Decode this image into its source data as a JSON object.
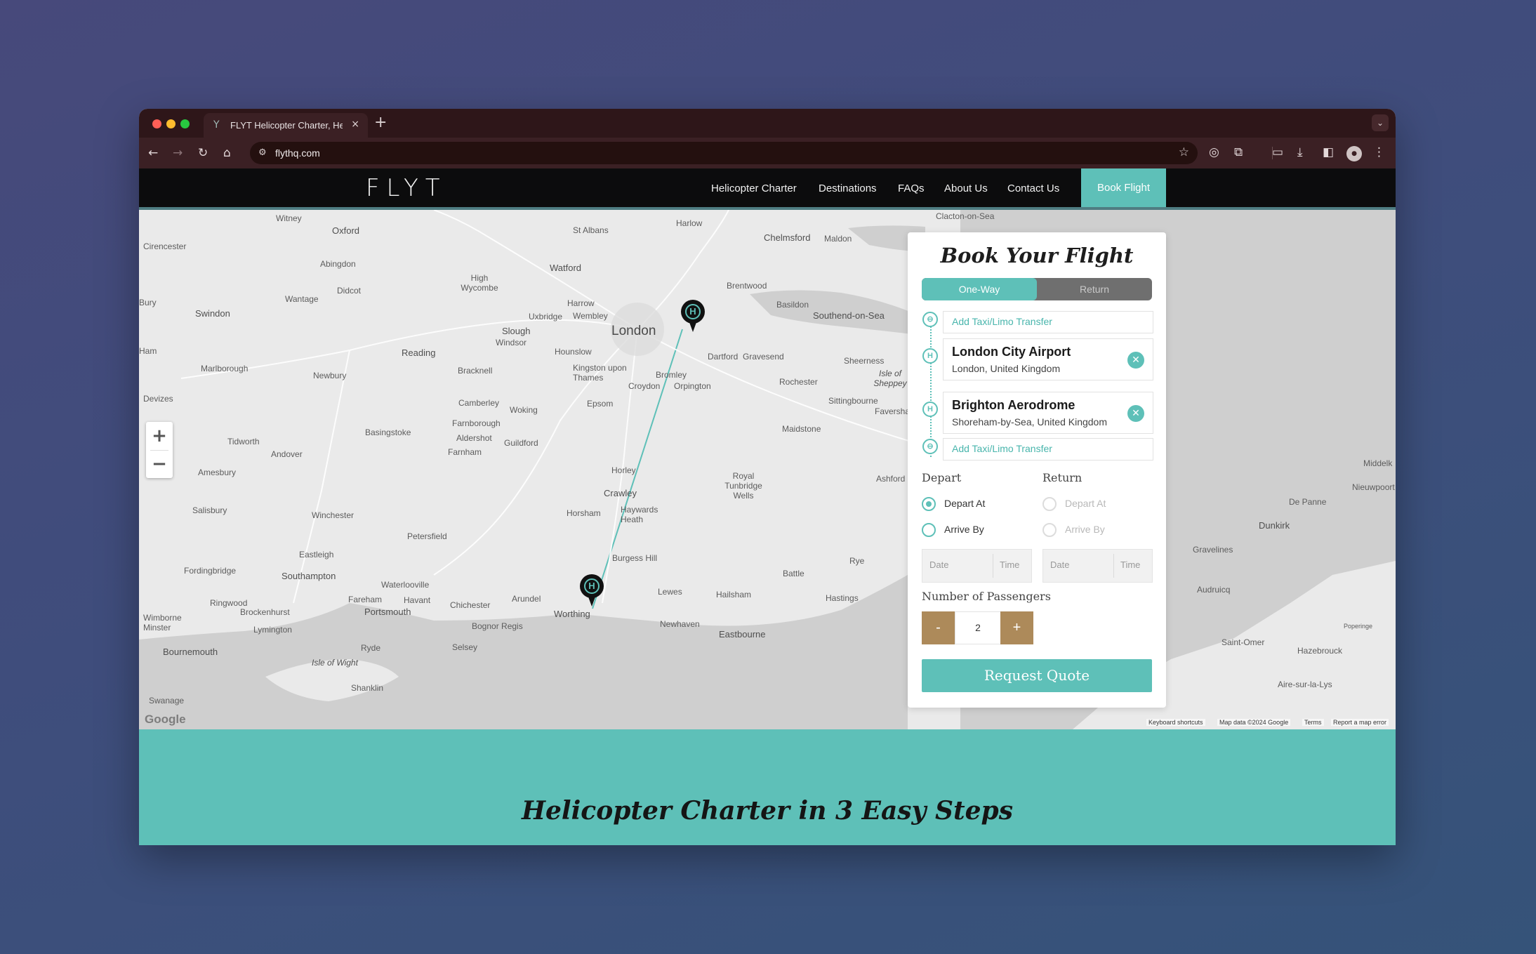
{
  "browser": {
    "tab_title": "FLYT Helicopter Charter, Hel",
    "tab_close": "×",
    "new_tab": "+",
    "tab_menu": "⌄",
    "url": "flythq.com"
  },
  "site": {
    "logo": "FLYT",
    "nav": [
      "Helicopter Charter",
      "Destinations",
      "FAQs",
      "About Us",
      "Contact Us"
    ],
    "book_button": "Book Flight"
  },
  "map": {
    "zoom_in": "+",
    "zoom_out": "−",
    "google": "Google",
    "attribution": [
      "Keyboard shortcuts",
      "Map data ©2024 Google",
      "Terms",
      "Report a map error"
    ],
    "pin_label": "H",
    "route_color": "#5ec0b8",
    "places": [
      "Witney",
      "Oxford",
      "St Albans",
      "Harlow",
      "Chelmsford",
      "Maldon",
      "Clacton-on-Sea",
      "Cirencester",
      "Abingdon",
      "Watford",
      "High Wycombe",
      "Brentwood",
      "Didcot",
      "Wantage",
      "Harrow",
      "Wembley",
      "Basildon",
      "Southend-on-Sea",
      "Swindon",
      "Uxbridge",
      "Slough",
      "London",
      "Windsor",
      "Reading",
      "Hounslow",
      "Kingston upon Thames",
      "Dartford",
      "Gravesend",
      "Marlborough",
      "Newbury",
      "Bracknell",
      "Bromley",
      "Orpington",
      "Rochester",
      "Sheerness",
      "Isle of Sheppey",
      "Devizes",
      "Croydon",
      "Epsom",
      "Camberley",
      "Woking",
      "Sittingbourne",
      "Faversha",
      "Farnborough",
      "Basingstoke",
      "Aldershot",
      "Guildford",
      "Maidstone",
      "Tidworth",
      "Andover",
      "Farnham",
      "Amesbury",
      "Horley",
      "Royal Tunbridge Wells",
      "Ashford",
      "Crawley",
      "Salisbury",
      "Winchester",
      "Horsham",
      "Petersfield",
      "Haywards Heath",
      "Burgess Hill",
      "Eastleigh",
      "Fordingbridge",
      "Southampton",
      "Waterlooville",
      "Rye",
      "Battle",
      "Lewes",
      "Hailsham",
      "Ringwood",
      "Fareham",
      "Havant",
      "Chichester",
      "Arundel",
      "Worthing",
      "Hastings",
      "Brockenhurst",
      "Portsmouth",
      "Wimborne Minster",
      "Lymington",
      "Bognor Regis",
      "Newhaven",
      "Eastbourne",
      "Bournemouth",
      "Ryde",
      "Selsey",
      "Isle of Wight",
      "Shanklin",
      "Swanage",
      "Middelk",
      "Nieuwpoort",
      "De Panne",
      "Dunkirk",
      "Gravelines",
      "Audruicq",
      "Saint-Omer",
      "Hazebrouck",
      "Aire-sur-la-Lys",
      "Poperinge",
      "Bury",
      "Ham"
    ]
  },
  "booking": {
    "title": "Book Your Flight",
    "trip_types": [
      "One-Way",
      "Return"
    ],
    "taxi_label": "Add Taxi/Limo Transfer",
    "route_icon_h": "H",
    "route_icon_taxi": "⊖",
    "origin": {
      "name": "London City Airport",
      "sub": "London, United Kingdom"
    },
    "destination": {
      "name": "Brighton Aerodrome",
      "sub": "Shoreham-by-Sea, United Kingdom"
    },
    "clear": "✕",
    "depart_title": "Depart",
    "return_title": "Return",
    "depart_at": "Depart At",
    "arrive_by": "Arrive By",
    "date_placeholder": "Date",
    "time_placeholder": "Time",
    "passengers_title": "Number of Passengers",
    "passengers": "2",
    "minus": "-",
    "plus": "+",
    "quote_button": "Request Quote"
  },
  "section": {
    "title": "Helicopter Charter in 3 Easy Steps"
  }
}
